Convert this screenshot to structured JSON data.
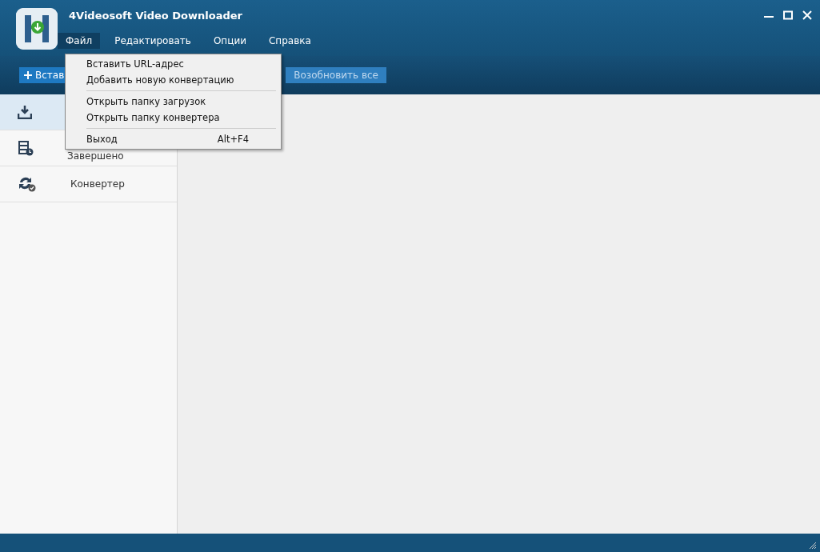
{
  "window": {
    "title": "4Videosoft Video Downloader"
  },
  "menubar": [
    {
      "label": "Файл",
      "selected": true
    },
    {
      "label": "Редактировать",
      "selected": false
    },
    {
      "label": "Опции",
      "selected": false
    },
    {
      "label": "Справка",
      "selected": false
    }
  ],
  "toolbar": [
    {
      "label": "Встав",
      "kind": "add"
    },
    {
      "label": "Возобновить все",
      "kind": "plain"
    }
  ],
  "sidebar": {
    "items": [
      {
        "kind": "download",
        "selected": true
      },
      {
        "label": "Завершено",
        "kind": "film",
        "selected": false
      },
      {
        "label": "Конвертер",
        "kind": "convert",
        "selected": false
      }
    ]
  },
  "file_menu": {
    "groups": [
      [
        {
          "label": "Вставить URL-адрес"
        },
        {
          "label": "Добавить новую конвертацию"
        }
      ],
      [
        {
          "label": "Открыть папку загрузок"
        },
        {
          "label": "Открыть папку конвертера"
        }
      ],
      [
        {
          "label": "Выход",
          "shortcut": "Alt+F4"
        }
      ]
    ]
  }
}
